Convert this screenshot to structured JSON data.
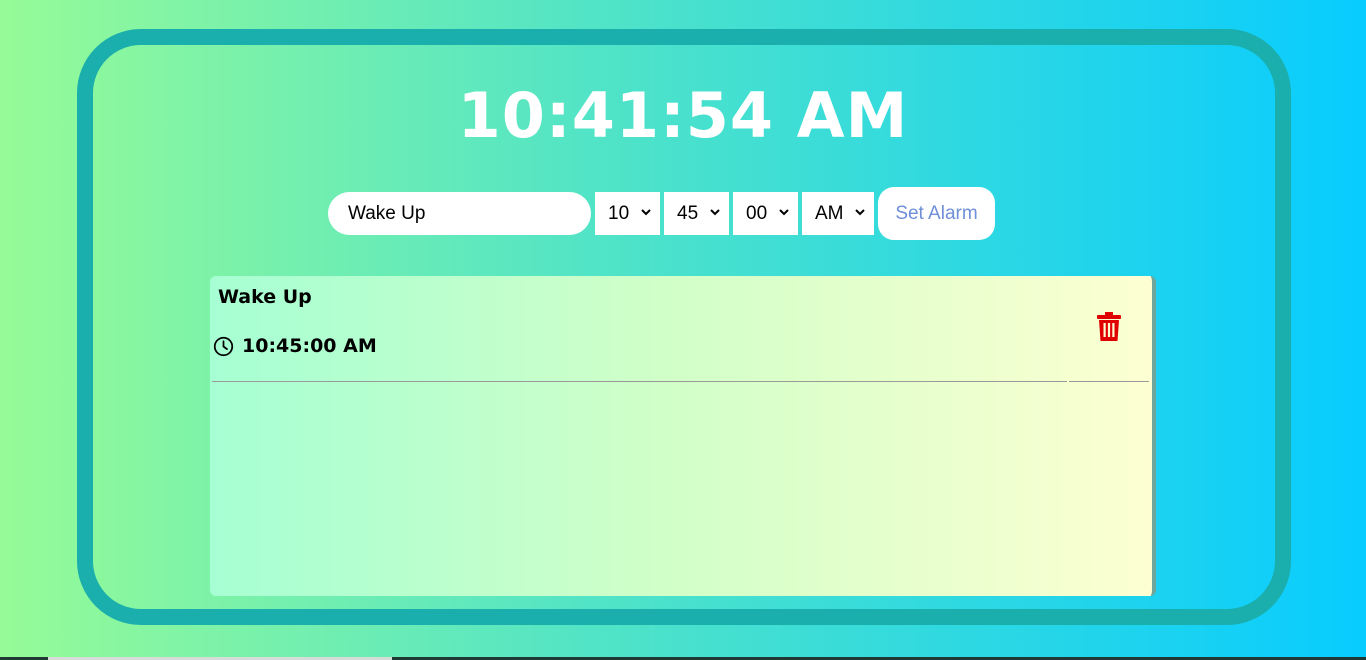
{
  "clock": {
    "time": "10:41:54 AM"
  },
  "form": {
    "name_value": "Wake Up",
    "hour_value": "10",
    "minute_value": "45",
    "second_value": "00",
    "ampm_value": "AM",
    "set_label": "Set Alarm"
  },
  "alarms": [
    {
      "name": "Wake Up",
      "time": "10:45:00 AM",
      "icon": "clock-icon",
      "delete_icon": "trash-icon"
    }
  ],
  "colors": {
    "frame": "#1aaeac",
    "delete": "#e00000",
    "button_text": "#6f8fd8"
  }
}
